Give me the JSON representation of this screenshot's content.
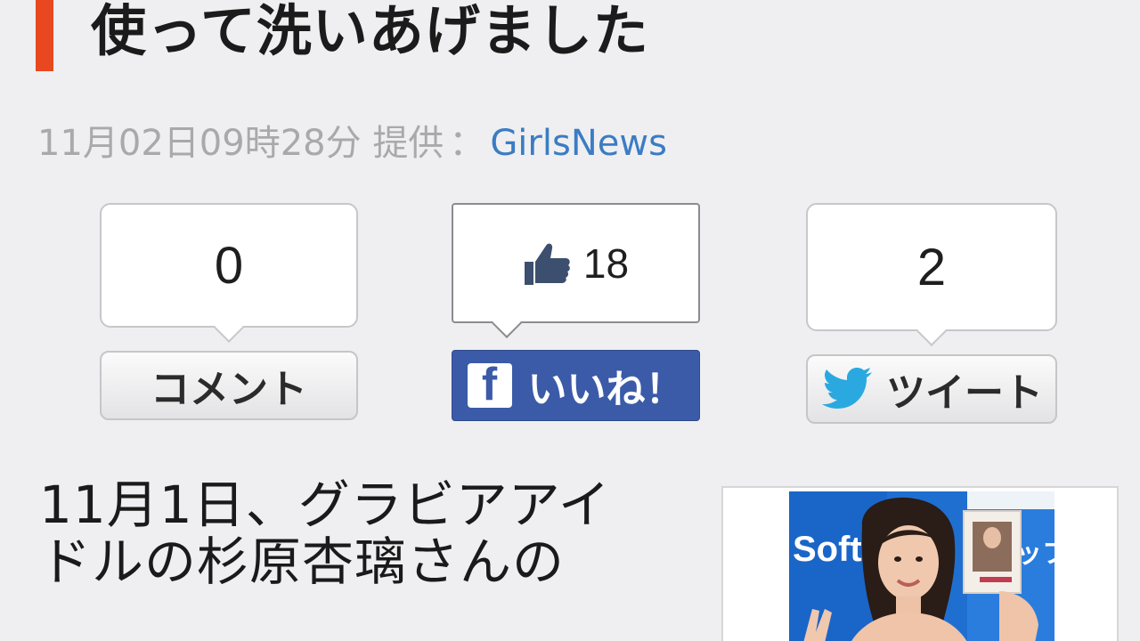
{
  "article": {
    "title": "使って洗いあげました",
    "date": "11月02日09時28分",
    "provider_label": "提供",
    "provider_sep": "：",
    "provider_name": "GirlsNews",
    "body_lines": [
      "11月1日、グラビアアイ",
      "ドルの杉原杏璃さんの"
    ]
  },
  "social": {
    "comment": {
      "count": "0",
      "label": "コメント"
    },
    "facebook": {
      "count": "18",
      "label": "いいね！",
      "logo_glyph": "f"
    },
    "twitter": {
      "count": "2",
      "label": "ツイート"
    }
  },
  "photo": {
    "banner_text": "Soft",
    "banner_text_right": "ッフ"
  },
  "colors": {
    "accent": "#e8471f",
    "link": "#3b7cc4",
    "facebook": "#3b5ba8",
    "twitter": "#2aa9e0",
    "meta_text": "#a9a9ab"
  },
  "icons": {
    "like": "thumbs-up-icon",
    "facebook": "facebook-logo-icon",
    "twitter": "twitter-bird-icon"
  }
}
